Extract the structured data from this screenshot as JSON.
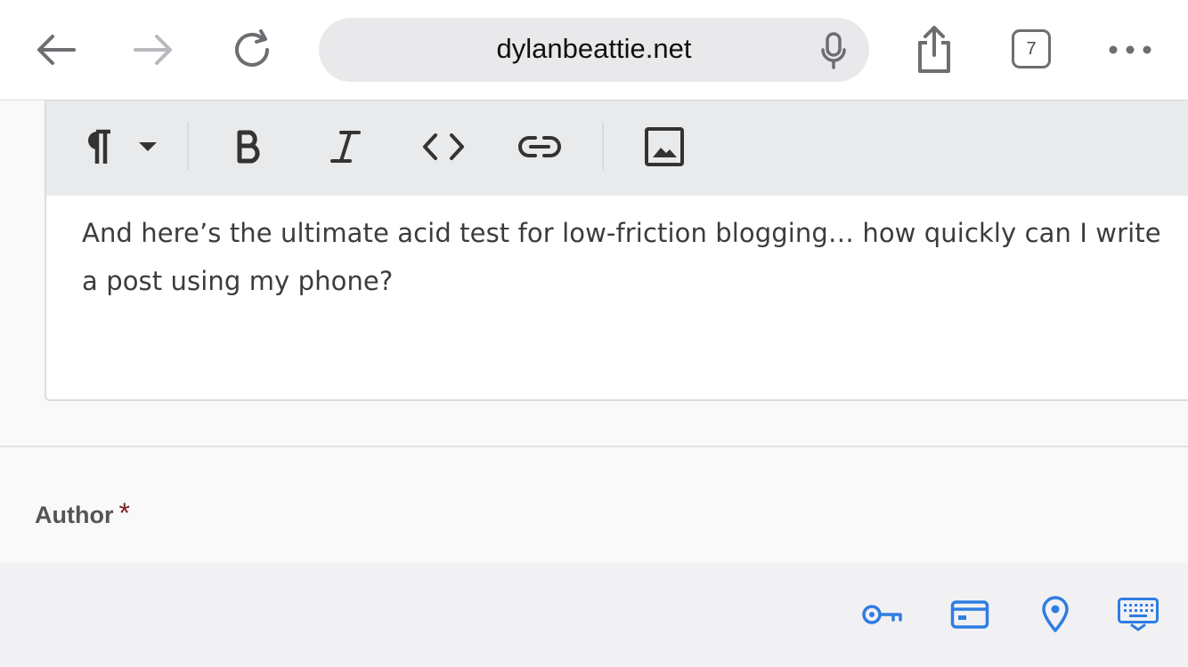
{
  "browser": {
    "url": "dylanbeattie.net",
    "tab_count": "7",
    "icons": {
      "back": "arrow-left-icon",
      "forward": "arrow-right-icon",
      "reload": "reload-icon",
      "mic": "microphone-icon",
      "share": "share-icon",
      "tabs": "tabs-icon",
      "more": "more-icon"
    }
  },
  "editor": {
    "toolbar": [
      "paragraph-icon",
      "dropdown-caret-icon",
      "bold-icon",
      "italic-icon",
      "code-icon",
      "link-icon",
      "image-icon"
    ],
    "body_lines": [
      "And here’s the ultimate acid test for low-friction blogging… how quickly can I write",
      "a post using my phone?"
    ]
  },
  "form": {
    "author_label": "Author",
    "required_marker": "*"
  },
  "accessory_bar": {
    "icons": [
      "key-icon",
      "credit-card-icon",
      "location-pin-icon",
      "keyboard-icon"
    ],
    "accent": "#2f7de1"
  },
  "colors": {
    "icon_gray": "#6d6d72",
    "disabled_gray": "#b8b8bd",
    "toolbar_bg": "#e9eaec",
    "required": "#7a1f1f"
  }
}
